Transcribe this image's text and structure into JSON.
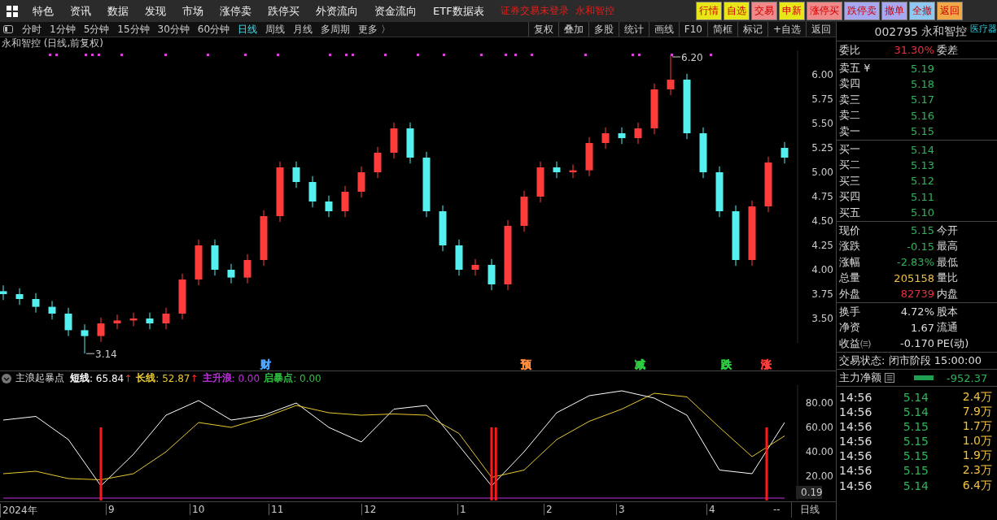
{
  "menu_bar": {
    "items": [
      "特色",
      "资讯",
      "数据",
      "发现",
      "市场",
      "涨停卖",
      "跌停买",
      "外资流向",
      "资金流向",
      "ETF数据表"
    ],
    "login_status": "证券交易未登录",
    "account_name": "永和智控",
    "buttons": [
      {
        "label": "行情",
        "color": "#e6e619"
      },
      {
        "label": "自选",
        "color": "#e6e619"
      },
      {
        "label": "交易",
        "color": "#f08a8a"
      },
      {
        "label": "申新",
        "color": "#e6e619"
      },
      {
        "label": "涨停买",
        "color": "#f08a8a"
      },
      {
        "label": "跌停卖",
        "color": "#a8a8f0"
      },
      {
        "label": "撤单",
        "color": "#a8a8f0"
      },
      {
        "label": "全撤",
        "color": "#8fc8f0"
      },
      {
        "label": "返回",
        "color": "#f0a848"
      }
    ]
  },
  "period_tabs": [
    {
      "label": "分时",
      "selected": false
    },
    {
      "label": "1分钟",
      "selected": false
    },
    {
      "label": "5分钟",
      "selected": false
    },
    {
      "label": "15分钟",
      "selected": false
    },
    {
      "label": "30分钟",
      "selected": false
    },
    {
      "label": "60分钟",
      "selected": false
    },
    {
      "label": "日线",
      "selected": true
    },
    {
      "label": "周线",
      "selected": false
    },
    {
      "label": "月线",
      "selected": false
    },
    {
      "label": "多周期",
      "selected": false
    },
    {
      "label": "更多 〉",
      "selected": false
    }
  ],
  "tool_buttons": [
    "复权",
    "叠加",
    "多股",
    "统计",
    "画线",
    "F10",
    "简框",
    "标记",
    "+自选",
    "返回"
  ],
  "chart_title": "永和智控 (日线,前复权)",
  "price_chart": {
    "chart_data": {
      "type": "candlestick",
      "ylim": [
        3.25,
        6.25
      ],
      "yticks": [
        {
          "value": 6,
          "label": "6.00"
        },
        {
          "value": 5.75,
          "label": "5.75"
        },
        {
          "value": 5.5,
          "label": "5.50"
        },
        {
          "value": 5.25,
          "label": "5.25"
        },
        {
          "value": 5,
          "label": "5.00"
        },
        {
          "value": 4.75,
          "label": "4.75"
        },
        {
          "value": 4.5,
          "label": "4.50"
        },
        {
          "value": 4.25,
          "label": "4.25"
        },
        {
          "value": 4,
          "label": "4.00"
        },
        {
          "value": 3.75,
          "label": "3.75"
        },
        {
          "value": 3.5,
          "label": "3.50"
        }
      ],
      "categories": [
        null,
        null,
        null,
        null,
        null,
        null,
        null,
        null,
        null,
        null,
        null,
        null,
        null,
        null,
        null,
        null,
        null,
        null,
        null,
        null,
        null,
        null,
        null,
        null,
        null,
        null,
        null,
        null,
        null,
        null,
        null,
        null,
        null,
        null,
        null,
        null,
        null,
        null,
        null,
        null,
        null,
        null,
        null,
        null,
        null,
        null,
        null,
        null,
        null
      ],
      "ohlc": [
        [
          3.78,
          3.84,
          3.69,
          3.75
        ],
        [
          3.75,
          3.81,
          3.64,
          3.7
        ],
        [
          3.7,
          3.76,
          3.56,
          3.62
        ],
        [
          3.62,
          3.68,
          3.49,
          3.55
        ],
        [
          3.55,
          3.61,
          3.32,
          3.38
        ],
        [
          3.38,
          3.44,
          3.14,
          3.32
        ],
        [
          3.32,
          3.51,
          3.26,
          3.45
        ],
        [
          3.45,
          3.54,
          3.39,
          3.48
        ],
        [
          3.48,
          3.56,
          3.42,
          3.5
        ],
        [
          3.5,
          3.56,
          3.39,
          3.45
        ],
        [
          3.45,
          3.61,
          3.39,
          3.55
        ],
        [
          3.55,
          3.96,
          3.49,
          3.9
        ],
        [
          3.9,
          4.31,
          3.84,
          4.25
        ],
        [
          4.25,
          4.31,
          3.94,
          4.0
        ],
        [
          4.0,
          4.06,
          3.86,
          3.92
        ],
        [
          3.92,
          4.16,
          3.86,
          4.1
        ],
        [
          4.1,
          4.61,
          4.04,
          4.55
        ],
        [
          4.55,
          5.11,
          4.49,
          5.05
        ],
        [
          5.05,
          5.11,
          4.84,
          4.9
        ],
        [
          4.9,
          4.96,
          4.64,
          4.7
        ],
        [
          4.7,
          4.76,
          4.54,
          4.6
        ],
        [
          4.6,
          4.86,
          4.54,
          4.8
        ],
        [
          4.8,
          5.06,
          4.74,
          5.0
        ],
        [
          5.0,
          5.26,
          4.94,
          5.2
        ],
        [
          5.2,
          5.51,
          5.14,
          5.45
        ],
        [
          5.45,
          5.51,
          5.09,
          5.15
        ],
        [
          5.15,
          5.21,
          4.54,
          4.6
        ],
        [
          4.6,
          4.66,
          4.19,
          4.25
        ],
        [
          4.25,
          4.31,
          3.94,
          4.0
        ],
        [
          4.0,
          4.11,
          3.94,
          4.05
        ],
        [
          4.05,
          4.11,
          3.79,
          3.85
        ],
        [
          3.85,
          4.51,
          3.79,
          4.45
        ],
        [
          4.45,
          4.81,
          4.39,
          4.75
        ],
        [
          4.75,
          5.11,
          4.69,
          5.05
        ],
        [
          5.05,
          5.11,
          4.94,
          5.0
        ],
        [
          5.0,
          5.08,
          4.94,
          5.02
        ],
        [
          5.02,
          5.36,
          4.96,
          5.3
        ],
        [
          5.3,
          5.46,
          5.24,
          5.4
        ],
        [
          5.4,
          5.46,
          5.29,
          5.35
        ],
        [
          5.35,
          5.51,
          5.29,
          5.45
        ],
        [
          5.45,
          5.91,
          5.39,
          5.85
        ],
        [
          5.85,
          6.2,
          5.79,
          5.95
        ],
        [
          5.95,
          6.01,
          5.34,
          5.4
        ],
        [
          5.4,
          5.46,
          4.94,
          5.0
        ],
        [
          5.0,
          5.06,
          4.54,
          4.6
        ],
        [
          4.6,
          4.66,
          4.04,
          4.1
        ],
        [
          4.1,
          4.71,
          4.04,
          4.65
        ],
        [
          4.65,
          5.16,
          4.59,
          5.1
        ],
        [
          5.25,
          5.31,
          5.09,
          5.15
        ]
      ]
    },
    "low_label": "3.14",
    "high_label": "6.20",
    "event_markers": [
      {
        "text": "财",
        "color": "#4da6ff"
      },
      {
        "text": "预",
        "color": "#ff8c3c"
      },
      {
        "text": "减",
        "color": "#2ecc40"
      },
      {
        "text": "跌",
        "color": "#2ecc40"
      },
      {
        "text": "涨",
        "color": "#ff3c3c"
      }
    ]
  },
  "indicator": {
    "name": "主浪起暴点",
    "legend": [
      {
        "value": ": 65.84",
        "arrow": "↑"
      },
      {
        "value": ": 52.87",
        "arrow": "↑"
      },
      {
        "value": ": 0.00"
      },
      {
        "label": "启暴点",
        "color": "#30c040",
        "value": ": 0.00"
      }
    ],
    "current_value": "0.19",
    "chart_data": {
      "type": "line",
      "ylim": [
        0,
        94.67
      ],
      "yticks": [
        {
          "value": 80,
          "label": "80.00"
        },
        {
          "value": 60,
          "label": "60.00"
        },
        {
          "value": 40,
          "label": "40.00"
        },
        {
          "value": 20,
          "label": "20.00"
        }
      ],
      "series": [
        {
          "name": "短线",
          "color": "#ffffff",
          "values": [
            66,
            69,
            50,
            12,
            38,
            70,
            82,
            66,
            70,
            80,
            60,
            48,
            75,
            78,
            45,
            12,
            40,
            72,
            86,
            90,
            84,
            70,
            25,
            22,
            64
          ]
        },
        {
          "name": "长线",
          "color": "#e8c830",
          "values": [
            22,
            24,
            18,
            17,
            22,
            40,
            64,
            60,
            68,
            78,
            72,
            70,
            71,
            70,
            55,
            19,
            25,
            50,
            65,
            75,
            88,
            85,
            60,
            36,
            53
          ]
        },
        {
          "name": "主升浪",
          "color": "#c030e0",
          "values": [
            2,
            2,
            2,
            2,
            2,
            2,
            2,
            2,
            2,
            2,
            2,
            2,
            2,
            2,
            2,
            2,
            2,
            2,
            2,
            2,
            2,
            2,
            2,
            2,
            2
          ]
        }
      ]
    },
    "time_axis": [
      "2024年",
      "9",
      "10",
      "11",
      "12",
      "1",
      "2",
      "3",
      "4"
    ],
    "axis_end": "--",
    "period_label": "日线"
  },
  "quote_panel": {
    "code": "002795",
    "name": "永和智控",
    "sector_tag": "医疗器",
    "ratio": {
      "label": "委比",
      "value": "31.30%",
      "color": "#e8313f",
      "label2": "委差"
    },
    "asks": [
      {
        "label": "卖五 ¥",
        "price": "5.19"
      },
      {
        "label": "卖四",
        "price": "5.18"
      },
      {
        "label": "卖三",
        "price": "5.17"
      },
      {
        "label": "卖二",
        "price": "5.16"
      },
      {
        "label": "卖一",
        "price": "5.15"
      }
    ],
    "bids": [
      {
        "label": "买一",
        "price": "5.14"
      },
      {
        "label": "买二",
        "price": "5.13"
      },
      {
        "label": "买三",
        "price": "5.12"
      },
      {
        "label": "买四",
        "price": "5.11"
      },
      {
        "label": "买五",
        "price": "5.10"
      }
    ],
    "stats": [
      {
        "label": "现价",
        "value": "5.15",
        "color": "#2fb35a",
        "label2": "今开"
      },
      {
        "label": "涨跌",
        "value": "-0.15",
        "color": "#2fb35a",
        "label2": "最高"
      },
      {
        "label": "涨幅",
        "value": "-2.83%",
        "color": "#2fb35a",
        "label2": "最低"
      },
      {
        "label": "总量",
        "value": "205158",
        "color": "#f0c040",
        "label2": "量比"
      },
      {
        "label": "外盘",
        "value": "82739",
        "color": "#e8313f",
        "label2": "内盘"
      }
    ],
    "finance": [
      {
        "label": "换手",
        "value": "4.72%",
        "label2": "股本"
      },
      {
        "label": "净资",
        "value": "1.67",
        "label2": "流通"
      },
      {
        "label": "收益㈢",
        "value": "-0.170",
        "label2": "PE(动)"
      }
    ],
    "trade_status": "交易状态: 闭市阶段 15:00:00",
    "main_flow": {
      "label": "主力净额",
      "value": "-952.37"
    },
    "ticks": [
      {
        "time": "14:56",
        "price": "5.14",
        "volume": "2.4万"
      },
      {
        "time": "14:56",
        "price": "5.14",
        "volume": "7.9万"
      },
      {
        "time": "14:56",
        "price": "5.15",
        "volume": "1.7万"
      },
      {
        "time": "14:56",
        "price": "5.15",
        "volume": "1.0万"
      },
      {
        "time": "14:56",
        "price": "5.15",
        "volume": "1.9万"
      },
      {
        "time": "14:56",
        "price": "5.15",
        "volume": "2.3万"
      },
      {
        "time": "14:56",
        "price": "5.14",
        "volume": "6.4万"
      }
    ]
  }
}
